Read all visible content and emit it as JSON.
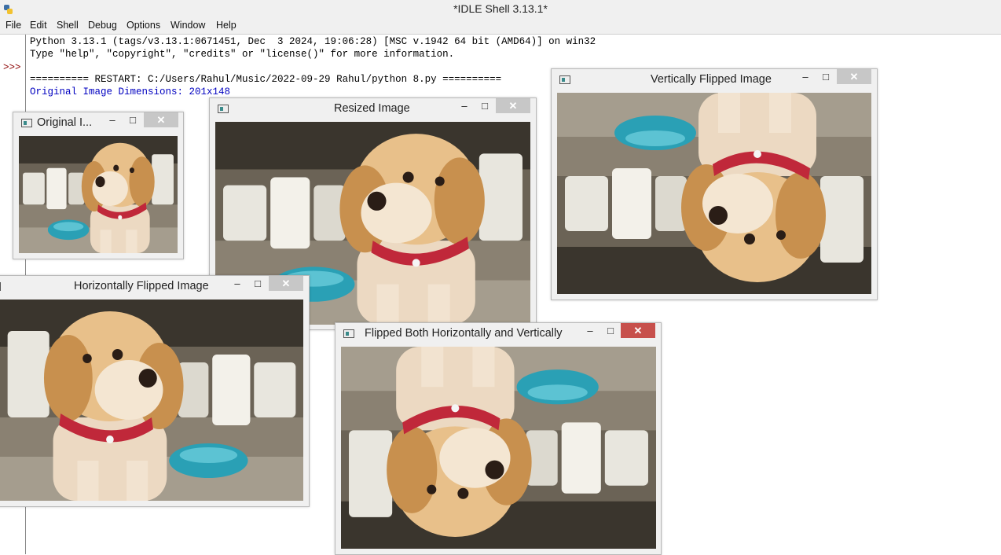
{
  "app": {
    "title": "*IDLE Shell 3.13.1*",
    "icon": "python-icon"
  },
  "menu": [
    "File",
    "Edit",
    "Shell",
    "Debug",
    "Options",
    "Window",
    "Help"
  ],
  "shell": {
    "prompt": ">>>",
    "lines": [
      "Python 3.13.1 (tags/v3.13.1:0671451, Dec  3 2024, 19:06:28) [MSC v.1942 64 bit (AMD64)] on win32",
      "Type \"help\", \"copyright\", \"credits\" or \"license()\" for more information.",
      "========== RESTART: C:/Users/Rahul/Music/2022-09-29 Rahul/python 8.py ==========",
      "Original Image Dimensions: 201x148"
    ]
  },
  "windows": {
    "original": {
      "title": "Original I...",
      "min": "–",
      "max": "□",
      "close": "✕"
    },
    "resized": {
      "title": "Resized Image",
      "min": "–",
      "max": "□",
      "close": "✕"
    },
    "vertical": {
      "title": "Vertically Flipped Image",
      "min": "–",
      "max": "□",
      "close": "✕"
    },
    "horizontal": {
      "title": "Horizontally Flipped Image",
      "min": "–",
      "max": "□",
      "close": "✕"
    },
    "both": {
      "title": "Flipped Both Horizontally and Vertically",
      "min": "–",
      "max": "□",
      "close": "✕"
    }
  },
  "colors": {
    "prompt": "#8b0000",
    "output_blue": "#0000c0",
    "close_active": "#c7504c"
  }
}
